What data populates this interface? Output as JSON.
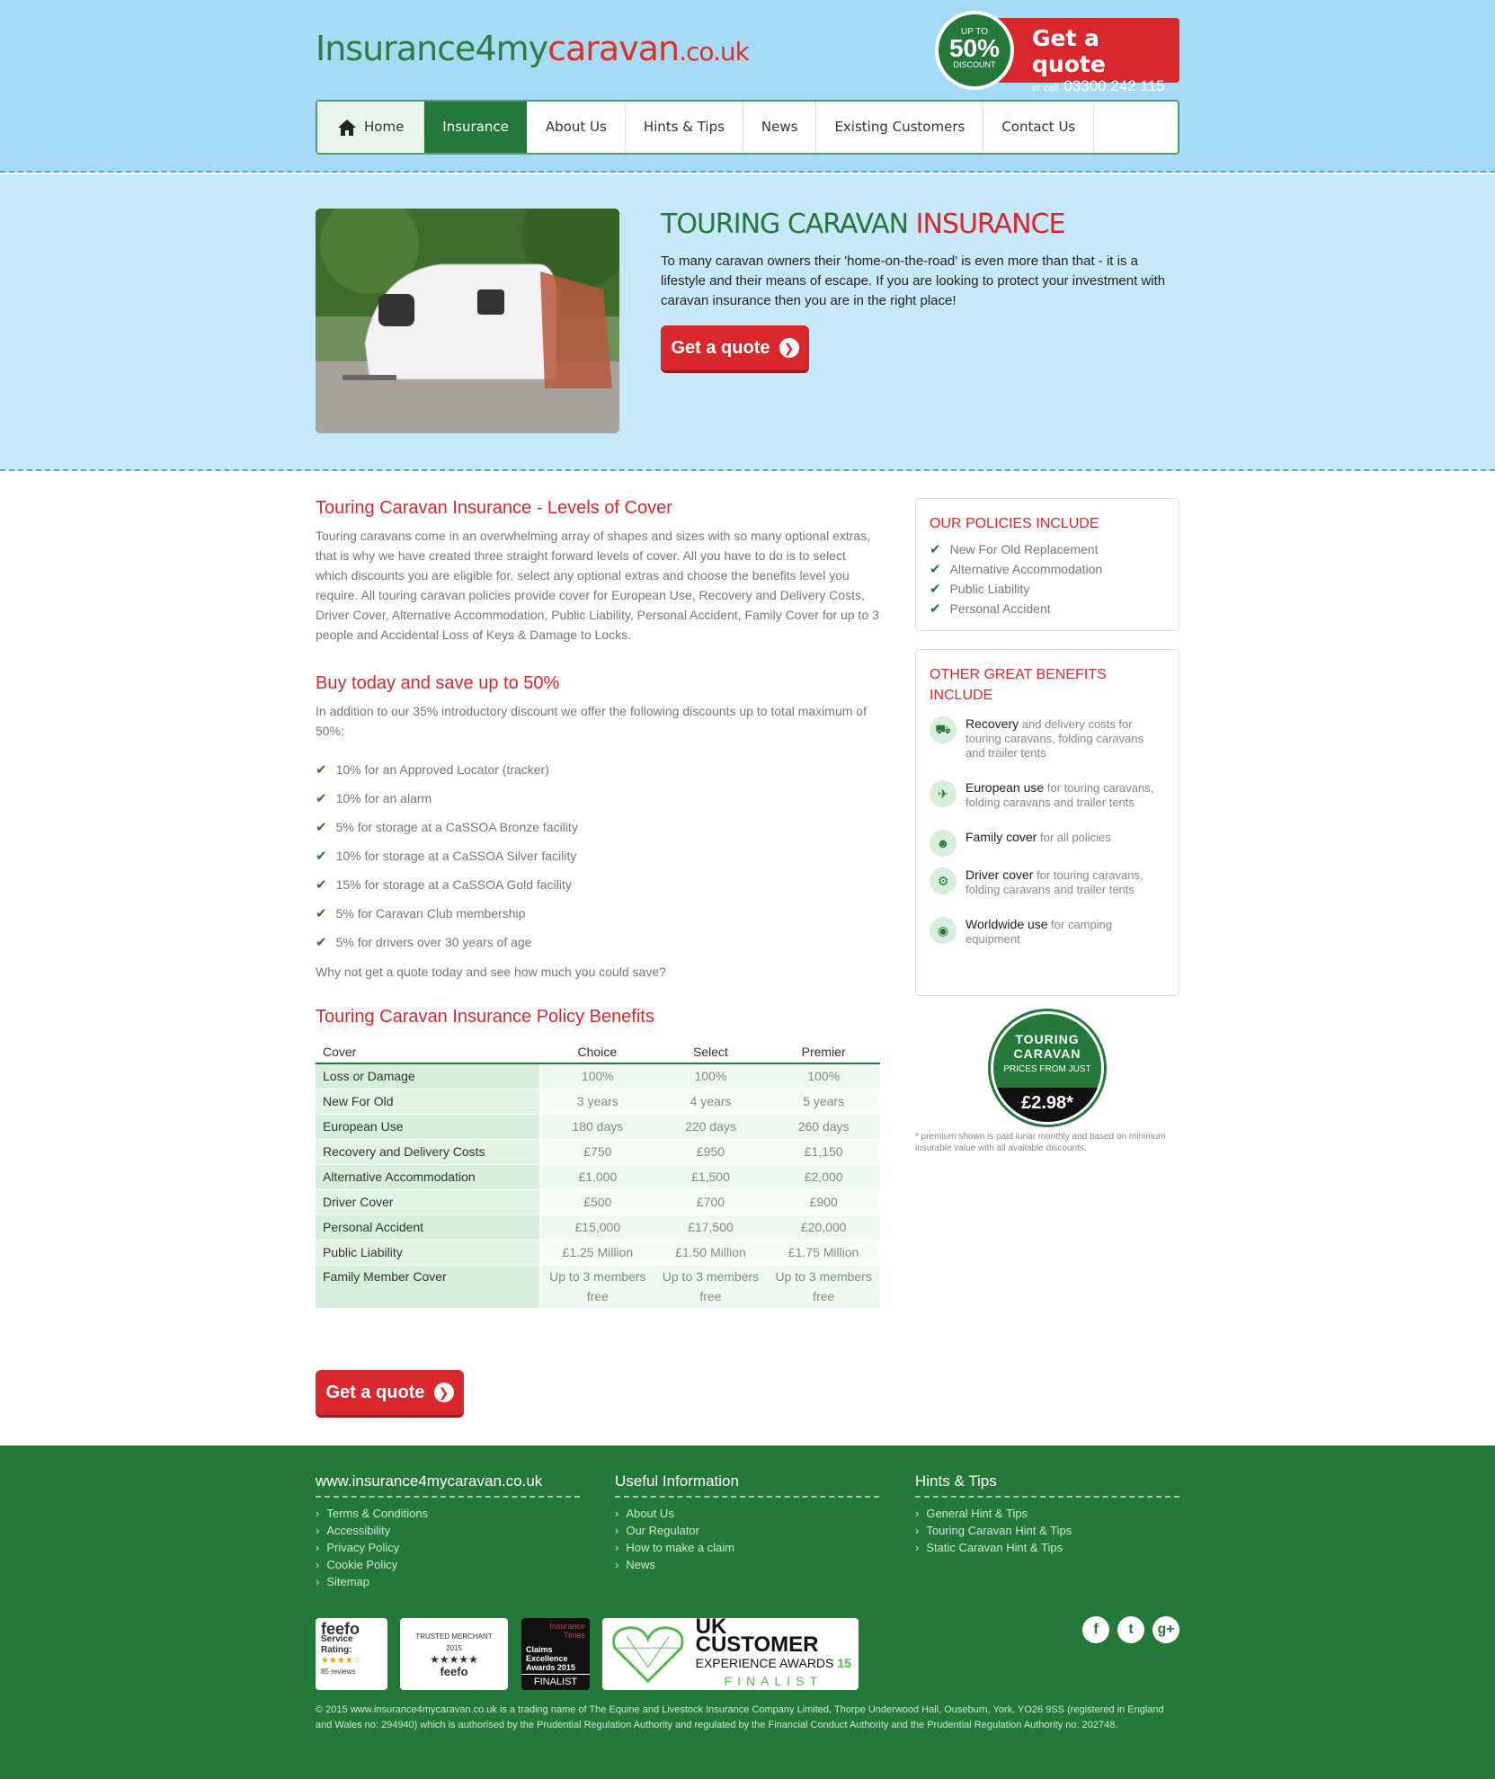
{
  "header": {
    "logo_a": "Insurance4my",
    "logo_b": "caravan",
    "logo_c": ".co.uk",
    "badge_up": "UP TO",
    "badge_pct": "50%",
    "badge_disc": "DISCOUNT",
    "quote_label": "Get a quote",
    "call_prefix": "or call",
    "phone": "03300 242 115"
  },
  "nav": {
    "items": [
      "Home",
      "Insurance",
      "About Us",
      "Hints & Tips",
      "News",
      "Existing Customers",
      "Contact Us"
    ]
  },
  "hero": {
    "title_a": "TOURING CARAVAN ",
    "title_b": "INSURANCE",
    "text": "To many caravan owners their 'home-on-the-road' is even more than that - it is a lifestyle and their means of escape. If you are looking to protect your investment with caravan insurance then you are in the right place!",
    "button": "Get a quote"
  },
  "main": {
    "h1": "Touring Caravan Insurance - Levels of Cover",
    "p1": "Touring caravans come in an overwhelming array of shapes and sizes with so many optional extras, that is why we have created three straight forward levels of cover. All you have to do is to select which discounts you are eligible for, select any optional extras and choose the benefits level you require. All touring caravan policies provide cover for European Use, Recovery and Delivery Costs, Driver Cover, Alternative Accommodation, Public Liability, Personal Accident, Family Cover for up to 3 people and Accidental Loss of Keys & Damage to Locks.",
    "h2": "Buy today and save up to 50%",
    "p2": "In addition to our 35% introductory discount we offer the following discounts up to total maximum of 50%:",
    "discounts": [
      "10% for an Approved Locator (tracker)",
      "10% for an alarm",
      "5% for storage at a CaSSOA Bronze facility",
      "10% for storage at a CaSSOA Silver facility",
      "15% for storage at a CaSSOA Gold facility",
      "5% for Caravan Club membership",
      "5% for drivers over 30 years of age"
    ],
    "p3": "Why not get a quote today and see how much you could save?",
    "h3": "Touring Caravan Insurance Policy Benefits",
    "table_head": [
      "Cover",
      "Choice",
      "Select",
      "Premier"
    ],
    "table_rows": [
      [
        "Loss or Damage",
        "100%",
        "100%",
        "100%"
      ],
      [
        "New For Old",
        "3 years",
        "4 years",
        "5 years"
      ],
      [
        "European Use",
        "180 days",
        "220 days",
        "260 days"
      ],
      [
        "Recovery and Delivery Costs",
        "£750",
        "£950",
        "£1,150"
      ],
      [
        "Alternative Accommodation",
        "£1,000",
        "£1,500",
        "£2,000"
      ],
      [
        "Driver Cover",
        "£500",
        "£700",
        "£900"
      ],
      [
        "Personal Accident",
        "£15,000",
        "£17,500",
        "£20,000"
      ],
      [
        "Public Liability",
        "£1.25 Million",
        "£1.50 Million",
        "£1.75 Million"
      ],
      [
        "Family Member Cover",
        "Up to 3 members free",
        "Up to 3 members free",
        "Up to 3 members free"
      ]
    ],
    "button": "Get a quote"
  },
  "side": {
    "t1": "OUR POLICIES INCLUDE",
    "policies": [
      "New For Old Replacement",
      "Alternative Accommodation",
      "Public Liability",
      "Personal Accident"
    ],
    "t2": "OTHER GREAT BENEFITS INCLUDE",
    "benefits": [
      {
        "b": "Recovery",
        "t": " and delivery costs for touring caravans, folding caravans and trailer tents"
      },
      {
        "b": "European use",
        "t": " for touring caravans, folding caravans and trailer tents"
      },
      {
        "b": "Family cover",
        "t": " for all policies"
      },
      {
        "b": "Driver cover",
        "t": " for touring caravans, folding caravans and trailer tents"
      },
      {
        "b": "Worldwide use",
        "t": " for camping equipment"
      }
    ],
    "badge_a": "TOURING CARAVAN",
    "badge_from": "PRICES FROM JUST",
    "badge_price": "£2.98*",
    "note": "* premium shown is paid lunar monthly and based on minimum insurable value with all available discounts."
  },
  "footer": {
    "c1": "www.insurance4mycaravan.co.uk",
    "l1": [
      "Terms & Conditions",
      "Accessibility",
      "Privacy Policy",
      "Cookie Policy",
      "Sitemap"
    ],
    "c2": "Useful Information",
    "l2": [
      "About Us",
      "Our Regulator",
      "How to make a claim",
      "News"
    ],
    "c3": "Hints & Tips",
    "l3": [
      "General Hint & Tips",
      "Touring Caravan Hint & Tips",
      "Static Caravan Hint & Tips"
    ],
    "feefo": "feefo",
    "service_rating": "Service Rating:",
    "reviews": "85 reviews",
    "trusted": "TRUSTED MERCHANT",
    "year": "2015",
    "claims_a": "Insurance Times",
    "claims_b": "Claims Excellence Awards 2015",
    "finalist": "FINALIST",
    "uk_a": "UK CUSTOMER",
    "uk_b": "EXPERIENCE AWARDS",
    "uk_c": "15",
    "uk_d": "FINALIST",
    "copyright": "© 2015 www.insurance4mycaravan.co.uk is a trading name of The Equine and Livestock Insurance Company Limited, Thorpe Underwood Hall, Ouseburn, York, YO26 9SS (registered in England and Wales no: 294940) which is authorised by the Prudential Regulation Authority and regulated by the Financial Conduct Authority and the Prudential Regulation Authority no: 202748."
  }
}
